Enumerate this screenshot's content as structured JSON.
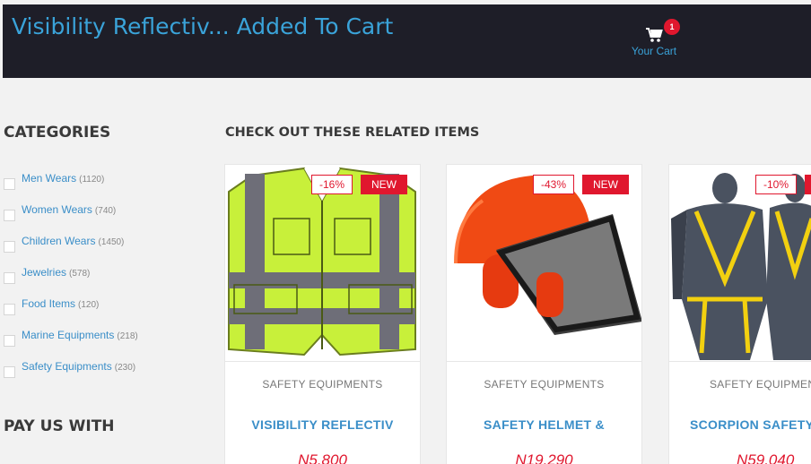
{
  "header": {
    "title": "Visibility Reflectiv... Added To Cart",
    "cart_count": "1",
    "cart_label": "Your Cart"
  },
  "sidebar": {
    "categories_heading": "CATEGORIES",
    "categories": [
      {
        "label": "Men Wears",
        "count": "(1120)"
      },
      {
        "label": "Women Wears",
        "count": "(740)"
      },
      {
        "label": "Children Wears",
        "count": "(1450)"
      },
      {
        "label": "Jewelries",
        "count": "(578)"
      },
      {
        "label": "Food Items",
        "count": "(120)"
      },
      {
        "label": "Marine Equipments",
        "count": "(218)"
      },
      {
        "label": "Safety Equipments",
        "count": "(230)"
      }
    ],
    "pay_heading": "PAY US WITH"
  },
  "related": {
    "heading": "CHECK OUT THESE RELATED ITEMS",
    "products": [
      {
        "discount": "-16%",
        "new_label": "NEW",
        "category": "SAFETY EQUIPMENTS",
        "name": "VISIBILITY REFLECTIV",
        "price": "N5,800"
      },
      {
        "discount": "-43%",
        "new_label": "NEW",
        "category": "SAFETY EQUIPMENTS",
        "name": "SAFETY HELMET &",
        "price": "N19,290"
      },
      {
        "discount": "-10%",
        "new_label": "",
        "category": "SAFETY EQUIPMEN",
        "name": "SCORPION SAFETY H",
        "price": "N59,040"
      }
    ]
  },
  "icons": {
    "cart": "shopping-cart-icon"
  },
  "colors": {
    "accent_blue": "#3aa3d9",
    "sale_red": "#e0172e",
    "header_bg": "#1e1e28"
  }
}
